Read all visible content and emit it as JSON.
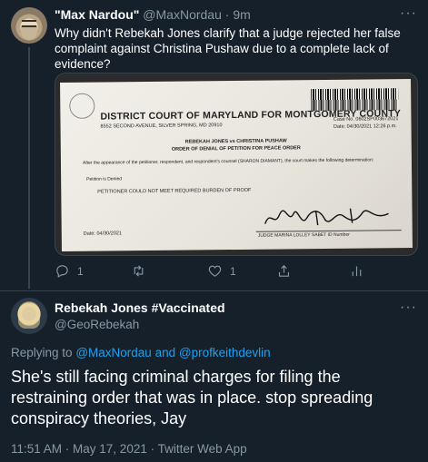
{
  "tweet1": {
    "display_name": "\"Max Nardou\"",
    "handle": "@MaxNordau",
    "separator": "·",
    "time": "9m",
    "text": "Why didn't Rebekah Jones clarify that a judge rejected her false complaint against Christina Pushaw due to a complete lack of evidence?",
    "more_label": "···",
    "avatar_icon": "bearded-man-avatar",
    "document": {
      "court": "DISTRICT COURT OF MARYLAND FOR MONTGOMERY COUNTY",
      "address": "8552 SECOND AVENUE, SILVER SPRING, MD  20910",
      "case_no": "Case No. 0602SP003672021",
      "case_date": "Date: 04/30/2021  12:26 p.m.",
      "parties": "REBEKAH JONES    vs    CHRISTINA PUSHAW",
      "order_title": "ORDER OF DENIAL OF PETITION FOR PEACE ORDER",
      "body": "After the appearance of the petitioner, respondent, and respondent's counsel (SHARON DIAMANT), the court makes the following determination:",
      "petition_status": "Petition is Denied",
      "finding": "PETITIONER COULD NOT MEET REQUIRED BURDEN OF PROOF",
      "date": "Date: 04/30/2021",
      "judge": "JUDGE MARINA LOLLEY SABET          ID Number"
    },
    "actions": {
      "reply_count": "1",
      "retweet_count": "",
      "like_count": "1"
    }
  },
  "tweet2": {
    "display_name": "Rebekah Jones #Vaccinated",
    "handle": "@GeoRebekah",
    "more_label": "···",
    "replying_prefix": "Replying to",
    "reply_to_1": "@MaxNordau",
    "reply_and": "and",
    "reply_to_2": "@profkeithdevlin",
    "text": "She's still facing criminal charges for filing the restraining order that was in place. stop spreading conspiracy theories, Jay",
    "meta": "11:51 AM · May 17, 2021 · Twitter Web App",
    "avatar_icon": "woman-avatar"
  },
  "colors": {
    "background": "#15202b",
    "muted": "#8899a6",
    "link": "#1da1f2",
    "border": "#38444d"
  }
}
